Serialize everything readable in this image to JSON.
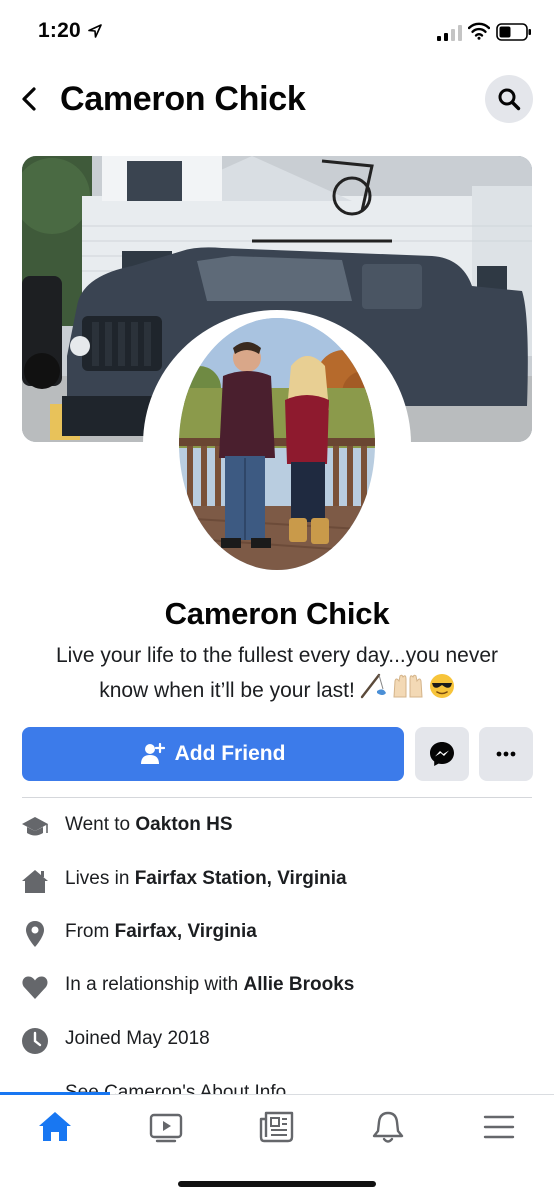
{
  "status_bar": {
    "time": "1:20"
  },
  "header": {
    "title": "Cameron Chick"
  },
  "profile": {
    "name": "Cameron Chick",
    "bio_line1": "Live your life to the fullest every day...you never",
    "bio_line2": "know when it’ll be your last!"
  },
  "actions": {
    "add_friend_label": "Add Friend"
  },
  "about": {
    "education": {
      "prefix": "Went to ",
      "value": "Oakton HS"
    },
    "lives": {
      "prefix": "Lives in ",
      "value": "Fairfax Station, Virginia"
    },
    "from": {
      "prefix": "From ",
      "value": "Fairfax, Virginia"
    },
    "relationship": {
      "prefix": "In a relationship with ",
      "value": "Allie Brooks"
    },
    "joined": {
      "text": "Joined May 2018"
    },
    "see_about": "See Cameron's About Info"
  },
  "icons": {
    "status": [
      "location-arrow-icon",
      "signal-icon",
      "wifi-icon",
      "battery-icon"
    ],
    "about": [
      "education-icon",
      "home-icon",
      "location-pin-icon",
      "heart-icon",
      "clock-icon"
    ],
    "tabs": [
      "home-tab-icon",
      "watch-tab-icon",
      "news-tab-icon",
      "notifications-tab-icon",
      "menu-tab-icon"
    ]
  },
  "colors": {
    "accent": "#3c7bea",
    "active_tab": "#1877f2",
    "button_grey": "#e4e6eb"
  }
}
